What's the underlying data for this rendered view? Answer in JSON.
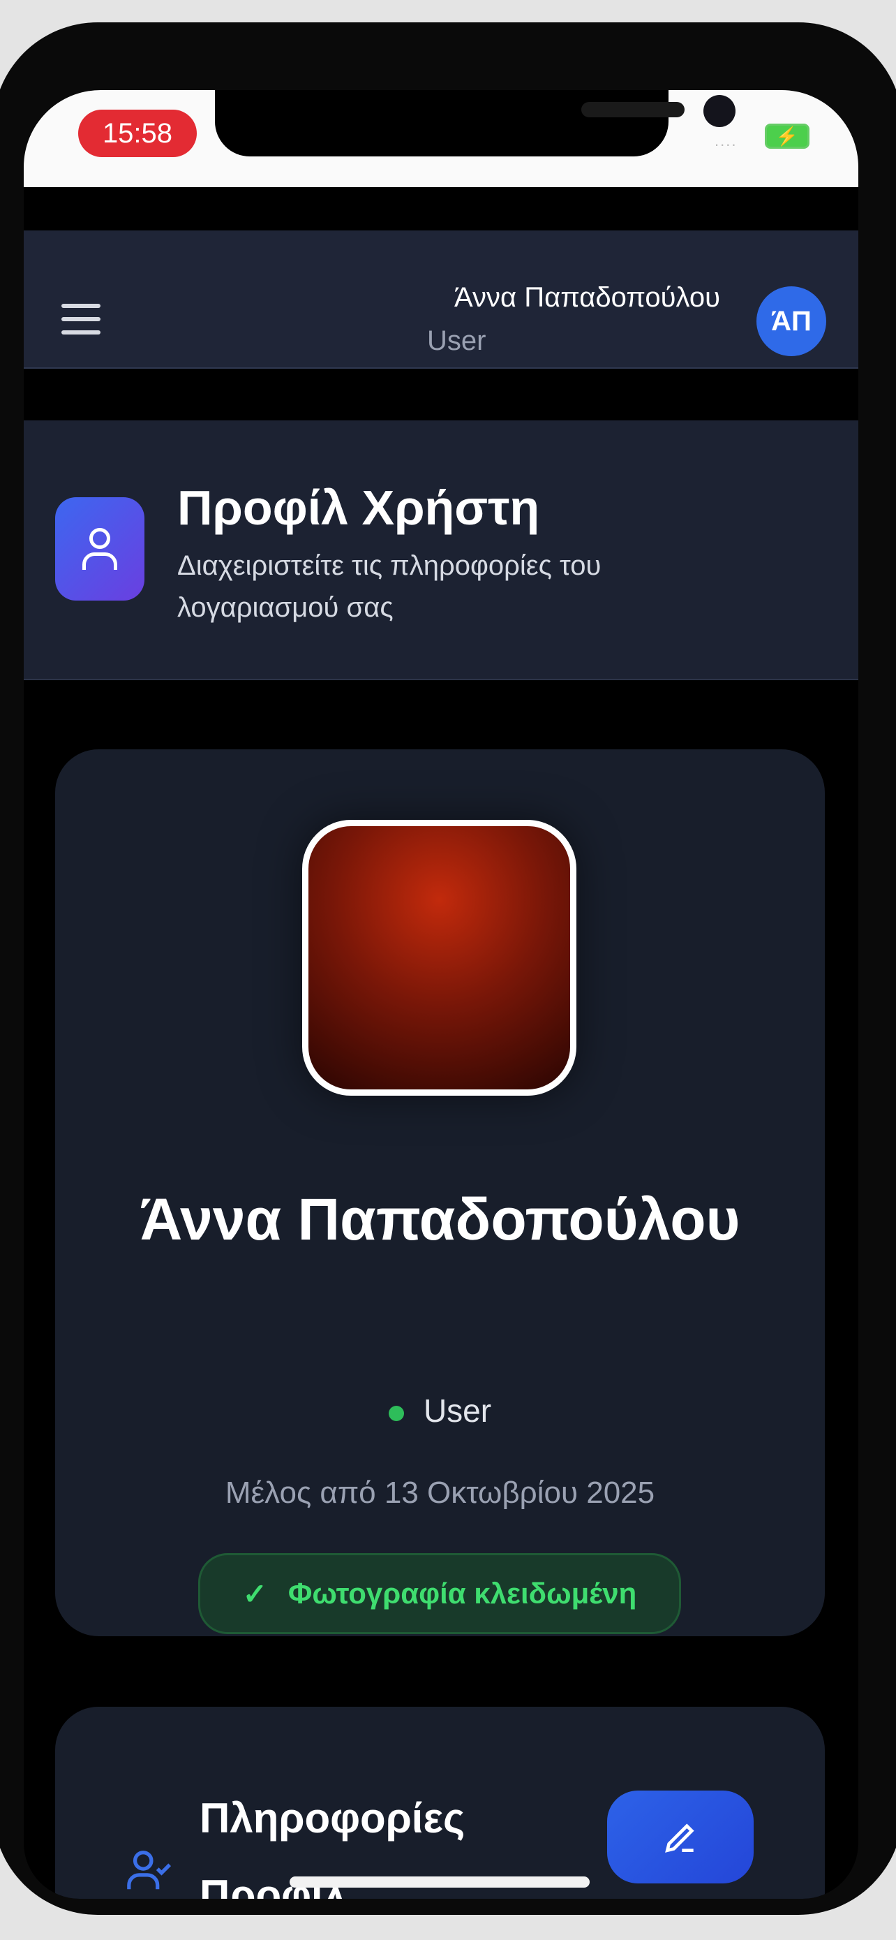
{
  "status_bar": {
    "time": "15:58",
    "signal": "....",
    "battery_icon": "battery-charging-icon"
  },
  "header": {
    "user_name": "Άννα Παπαδοπούλου",
    "user_role": "User",
    "avatar_initials": "ΆΠ"
  },
  "page_header": {
    "title": "Προφίλ Χρήστη",
    "subtitle": "Διαχειριστείτε τις πληροφορίες του λογαριασμού σας"
  },
  "profile": {
    "name": "Άννα Παπαδοπούλου",
    "role": "User",
    "member_since": "Μέλος από 13 Οκτωβρίου 2025",
    "photo_status": "Φωτογραφία κλειδωμένη"
  },
  "info_section": {
    "title": "Πληροφορίες Προφίλ"
  },
  "colors": {
    "accent": "#2f6ae8",
    "success": "#3fdd6f",
    "background": "#000000",
    "card": "#181e2b"
  }
}
